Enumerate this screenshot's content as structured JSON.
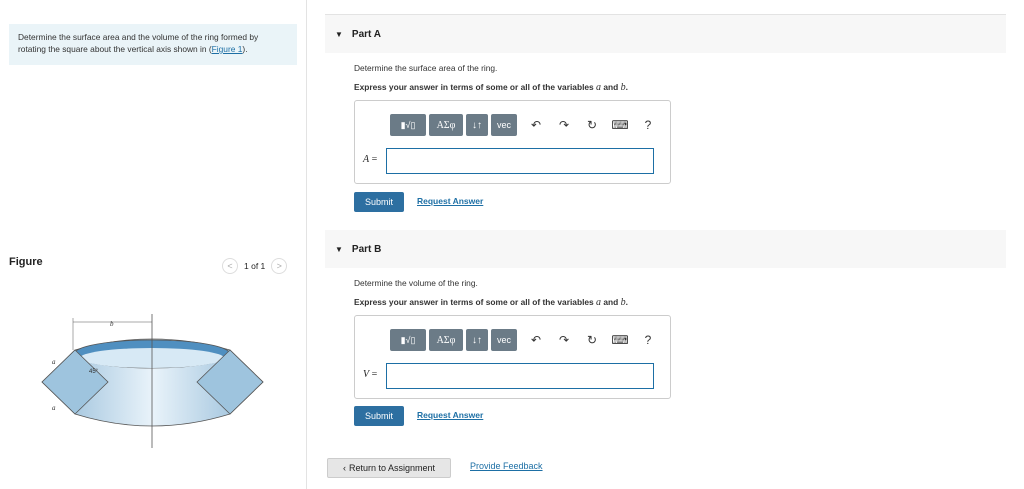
{
  "problem": {
    "text": "Determine the surface area and the volume of the ring formed by rotating the square about the vertical axis shown in (",
    "link": "Figure 1",
    "tail": ")."
  },
  "figure": {
    "title": "Figure",
    "pager": "1 of 1",
    "prev_glyph": "<",
    "next_glyph": ">",
    "label_b": "b",
    "label_a_top": "a",
    "label_a_bottom": "a",
    "label_angle": "45°"
  },
  "part_a": {
    "title": "Part A",
    "question": "Determine the surface area of the ring.",
    "instruction_pre": "Express your answer in terms of some or all of the variables ",
    "var1": "a",
    "instruction_mid": " and ",
    "var2": "b",
    "instruction_end": ".",
    "eq_var": "A",
    "eq_sign": " =",
    "submit": "Submit",
    "request": "Request Answer"
  },
  "part_b": {
    "title": "Part B",
    "question": "Determine the volume of the ring.",
    "instruction_pre": "Express your answer in terms of some or all of the variables ",
    "var1": "a",
    "instruction_mid": " and ",
    "var2": "b",
    "instruction_end": ".",
    "eq_var": "V",
    "eq_sign": " =",
    "submit": "Submit",
    "request": "Request Answer"
  },
  "toolbar": {
    "frac": "▮√▯",
    "greek": "ΑΣφ",
    "arrows": "↓↑",
    "vec": "vec",
    "undo": "↶",
    "redo": "↷",
    "reset": "↻",
    "keyboard": "⌨",
    "help": "?"
  },
  "footer": {
    "return": "Return to Assignment",
    "feedback": "Provide Feedback"
  }
}
